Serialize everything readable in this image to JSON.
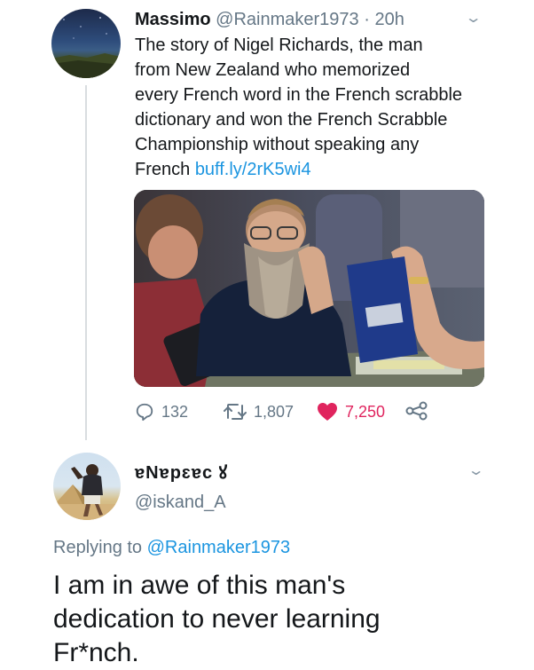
{
  "tweet": {
    "author_name": "Massimo",
    "author_handle": "@Rainmaker1973",
    "separator": "·",
    "time": "20h",
    "text_lines": [
      "The story of Nigel Richards, the man",
      "from New Zealand  who memorized",
      "every French word in the French scrabble",
      "dictionary and won the French Scrabble",
      "Championship without speaking any",
      "French"
    ],
    "link": "buff.ly/2rK5wi4",
    "stats": {
      "replies": "132",
      "retweets": "1,807",
      "likes": "7,250"
    }
  },
  "reply": {
    "author_name": "ɐNɐpɛɐc ꙋ",
    "author_handle": "@iskand_A",
    "replying_prefix": "Replying to",
    "replying_to": "@Rainmaker1973",
    "text_lines": [
      "I am in awe of this man's",
      "dedication to never learning",
      "Fr*nch."
    ]
  },
  "icons": {
    "reply": "reply-icon",
    "retweet": "retweet-icon",
    "like": "heart-icon",
    "share": "share-icon",
    "menu": "chevron-down-icon"
  },
  "colors": {
    "link": "#1b95e0",
    "secondary_text": "#657786",
    "like": "#e0245e",
    "primary_text": "#14171a"
  }
}
